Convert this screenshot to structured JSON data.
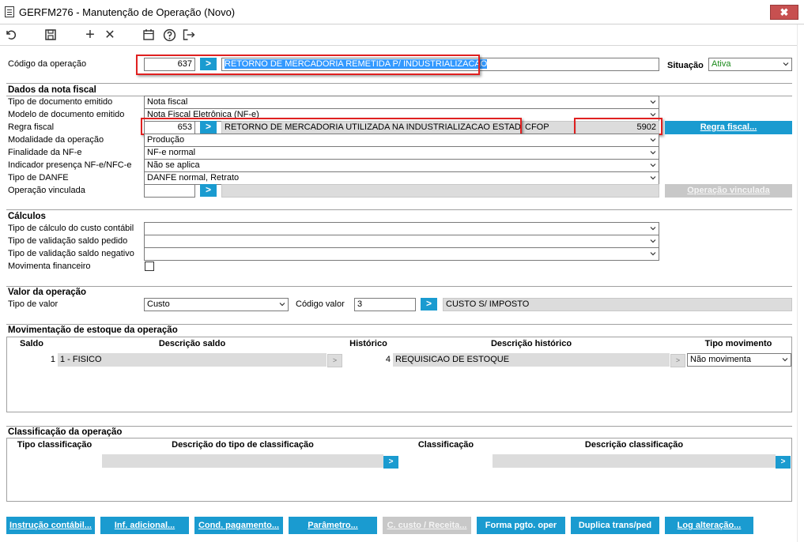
{
  "window": {
    "title": "GERFM276 - Manutenção de Operação (Novo)",
    "close_label": "✖"
  },
  "toolbar": {
    "icons": [
      "undo-icon",
      "save-icon",
      "add-icon",
      "cancel-icon",
      "calendar-icon",
      "help-icon",
      "exit-icon"
    ],
    "add_glyph": "+",
    "cancel_glyph": "✕"
  },
  "operacao": {
    "label": "Código da operação",
    "code": "637",
    "description": "RETORNO DE MERCADORIA REMETIDA P/ INDUSTRIALIZACAO",
    "situacao_label": "Situação",
    "situacao_value": "Ativa"
  },
  "nota": {
    "section": "Dados da nota fiscal",
    "tipo_doc_label": "Tipo de documento emitido",
    "tipo_doc_value": "Nota fiscal",
    "modelo_label": "Modelo de documento emitido",
    "modelo_value": "Nota Fiscal Eletrônica (NF-e)",
    "regra_label": "Regra fiscal",
    "regra_code": "653",
    "regra_desc": "RETORNO DE MERCADORIA UTILIZADA NA INDUSTRIALIZACAO ESTADUAL",
    "cfop_label": "CFOP",
    "cfop_value": "5902",
    "regra_btn": "Regra fiscal...",
    "modalidade_label": "Modalidade da operação",
    "modalidade_value": "Produção",
    "finalidade_label": "Finalidade da NF-e",
    "finalidade_value": "NF-e normal",
    "indicador_label": "Indicador presença NF-e/NFC-e",
    "indicador_value": "Não se aplica",
    "danfe_label": "Tipo de DANFE",
    "danfe_value": "DANFE normal, Retrato",
    "vinculada_label": "Operação vinculada",
    "vinculada_btn": "Operação vinculada"
  },
  "calculos": {
    "section": "Cálculos",
    "custo_label": "Tipo de cálculo do custo contábil",
    "saldo_pedido_label": "Tipo de validação saldo pedido",
    "saldo_negativo_label": "Tipo de validação saldo negativo",
    "movimenta_label": "Movimenta financeiro"
  },
  "valor": {
    "section": "Valor da operação",
    "tipo_label": "Tipo de valor",
    "tipo_value": "Custo",
    "codigo_label": "Código valor",
    "codigo_value": "3",
    "codigo_desc": "CUSTO S/ IMPOSTO"
  },
  "estoque": {
    "section": "Movimentação de estoque da operação",
    "headers": [
      "Saldo",
      "Descrição saldo",
      "Histórico",
      "Descrição histórico",
      "Tipo movimento"
    ],
    "row": {
      "saldo": "1",
      "desc_saldo": "1 - FISICO",
      "historico": "4",
      "desc_historico": "REQUISICAO DE ESTOQUE",
      "tipo_movimento": "Não movimenta"
    },
    "small_btn": ">"
  },
  "classificacao": {
    "section": "Classificação da operação",
    "headers": [
      "Tipo classificação",
      "Descrição do tipo de classificação",
      "Classificação",
      "Descrição classificação"
    ],
    "btn": ">"
  },
  "footer": {
    "buttons": [
      "Instrução contábil...",
      "Inf. adicional...",
      "Cond. pagamento...",
      "Parâmetro...",
      "C. custo / Receita...",
      "Forma pgto. oper",
      "Duplica trans/ped",
      "Log alteração..."
    ]
  },
  "arrow_glyph": ">"
}
